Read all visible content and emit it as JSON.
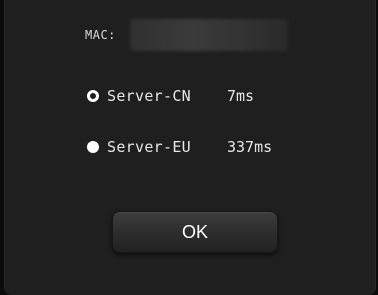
{
  "dialog": {
    "mac": {
      "label": "MAC:",
      "value": ""
    },
    "servers": [
      {
        "name": "Server-CN",
        "latency": "7ms",
        "selected": true
      },
      {
        "name": "Server-EU",
        "latency": "337ms",
        "selected": false
      }
    ],
    "ok_label": "OK"
  }
}
